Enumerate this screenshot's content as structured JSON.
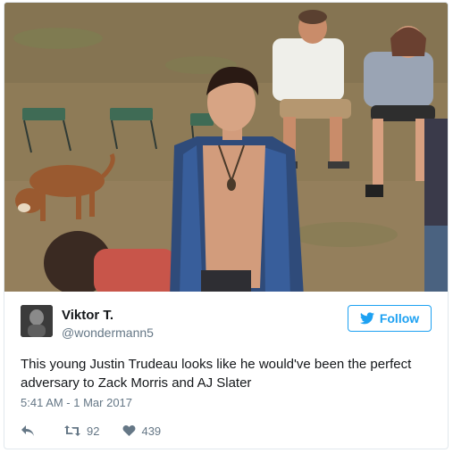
{
  "tweet": {
    "name": "Viktor T.",
    "handle": "@wondermann5",
    "follow_label": "Follow",
    "text": "This young Justin Trudeau looks like he would've been the perfect adversary to Zack Morris and AJ Slater",
    "timestamp": "5:41 AM - 1 Mar 2017",
    "retweets": "92",
    "likes": "439"
  },
  "icons": {
    "reply": "reply-icon",
    "retweet": "retweet-icon",
    "like": "heart-icon",
    "follow": "twitter-bird-icon"
  },
  "colors": {
    "accent": "#1da1f2",
    "text": "#14171a",
    "muted": "#657786",
    "border": "#e1e8ed"
  }
}
